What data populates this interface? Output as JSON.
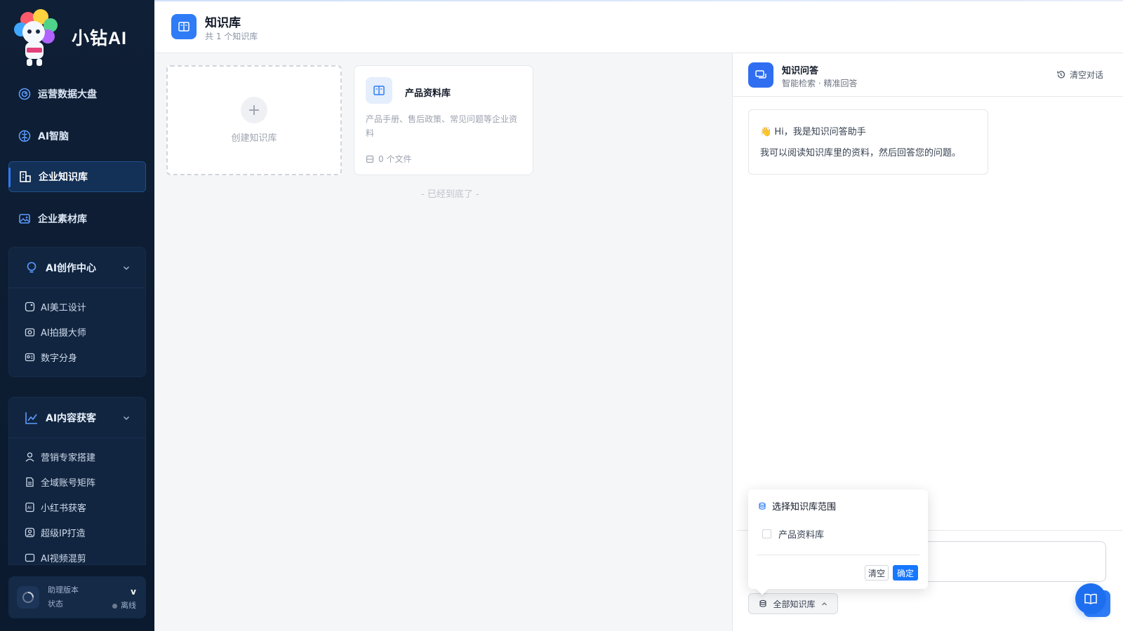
{
  "sidebar": {
    "brand": "小钻AI",
    "logo_badge": "小钻AI",
    "items": [
      {
        "label": "运营数据大盘",
        "icon": "dashboard-icon"
      },
      {
        "label": "AI智脑",
        "icon": "brain-icon"
      },
      {
        "label": "企业知识库",
        "icon": "building-icon",
        "active": true
      },
      {
        "label": "企业素材库",
        "icon": "image-icon"
      }
    ],
    "groups": [
      {
        "label": "AI创作中心",
        "icon": "bulb-icon",
        "children": [
          {
            "label": "AI美工设计"
          },
          {
            "label": "AI拍摄大师"
          },
          {
            "label": "数字分身"
          }
        ]
      },
      {
        "label": "AI内容获客",
        "icon": "chart-icon",
        "children": [
          {
            "label": "营销专家搭建"
          },
          {
            "label": "全域账号矩阵"
          },
          {
            "label": "小红书获客"
          },
          {
            "label": "超级IP打造"
          },
          {
            "label": "AI视频混剪"
          }
        ]
      }
    ],
    "status": {
      "version_label": "助理版本",
      "version_value": "v",
      "state_label": "状态",
      "state_value": "离线"
    }
  },
  "header": {
    "title": "知识库",
    "subtitle": "共 1 个知识库"
  },
  "main": {
    "create_label": "创建知识库",
    "kb_card": {
      "name": "产品资料库",
      "description": "产品手册、售后政策、常见问题等企业资料",
      "files": "0 个文件"
    },
    "end_note": "- 已经到底了 -"
  },
  "qa": {
    "title": "知识问答",
    "subtitle": "智能检索 · 精准回答",
    "clear_label": "清空对话",
    "greeting_emoji": "👋",
    "greeting": "Hi，我是知识问答助手",
    "intro": "我可以阅读知识库里的资料，然后回答您的问题。",
    "scope_button": "全部知识库"
  },
  "popover": {
    "title": "选择知识库范围",
    "option": "产品资料库",
    "clear_btn": "清空",
    "ok_btn": "确定"
  },
  "colors": {
    "accent": "#2f7cf6",
    "sidebar_bg": "#0f1f36",
    "ok_btn": "#1677ff"
  }
}
